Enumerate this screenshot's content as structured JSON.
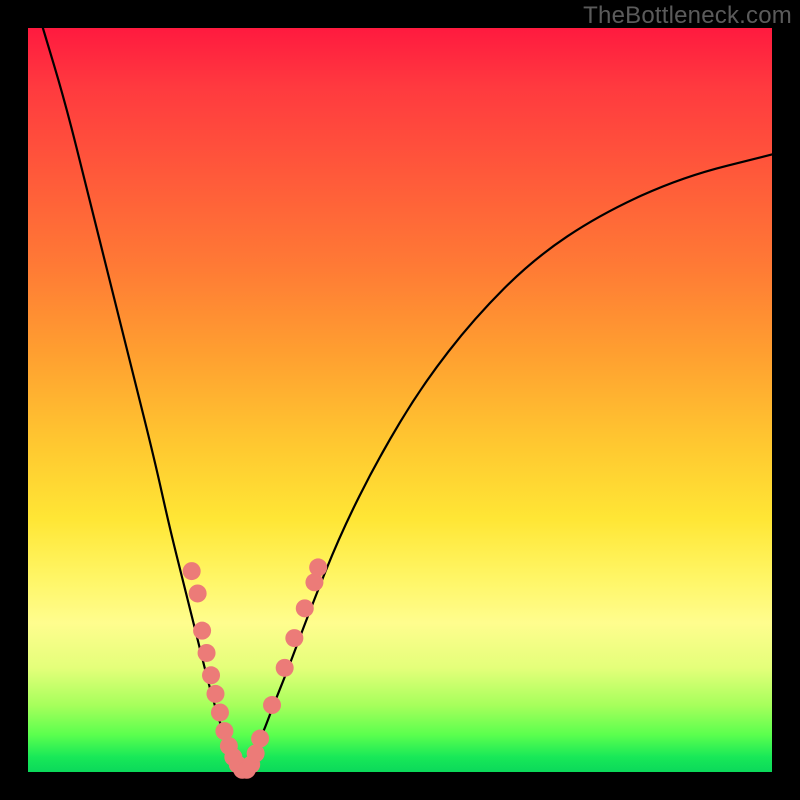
{
  "watermark": "TheBottleneck.com",
  "colors": {
    "background": "#000000",
    "curve": "#000000",
    "marker_fill": "#ec7b78",
    "marker_stroke": "#d85a5a"
  },
  "chart_data": {
    "type": "line",
    "title": "",
    "xlabel": "",
    "ylabel": "",
    "xlim": [
      0,
      100
    ],
    "ylim": [
      0,
      100
    ],
    "legend": false,
    "grid": false,
    "annotations": [
      "TheBottleneck.com"
    ],
    "series": [
      {
        "name": "bottleneck-curve-left",
        "x": [
          2,
          5,
          8,
          11,
          14,
          17,
          19,
          21,
          23,
          24.5,
          26,
          27,
          28,
          28.8
        ],
        "y": [
          100,
          90,
          78,
          66,
          54,
          42,
          33,
          25,
          17,
          11,
          6,
          3,
          1,
          0
        ]
      },
      {
        "name": "bottleneck-curve-right",
        "x": [
          28.8,
          30,
          31.5,
          33,
          35,
          38,
          42,
          47,
          53,
          60,
          68,
          77,
          88,
          100
        ],
        "y": [
          0,
          2,
          5,
          9,
          14,
          22,
          32,
          42,
          52,
          61,
          69,
          75,
          80,
          83
        ]
      }
    ],
    "markers": [
      {
        "x": 22.0,
        "y": 27.0
      },
      {
        "x": 22.8,
        "y": 24.0
      },
      {
        "x": 23.4,
        "y": 19.0
      },
      {
        "x": 24.0,
        "y": 16.0
      },
      {
        "x": 24.6,
        "y": 13.0
      },
      {
        "x": 25.2,
        "y": 10.5
      },
      {
        "x": 25.8,
        "y": 8.0
      },
      {
        "x": 26.4,
        "y": 5.5
      },
      {
        "x": 27.0,
        "y": 3.5
      },
      {
        "x": 27.6,
        "y": 2.0
      },
      {
        "x": 28.2,
        "y": 1.0
      },
      {
        "x": 28.8,
        "y": 0.3
      },
      {
        "x": 29.4,
        "y": 0.3
      },
      {
        "x": 30.0,
        "y": 1.0
      },
      {
        "x": 30.6,
        "y": 2.5
      },
      {
        "x": 31.2,
        "y": 4.5
      },
      {
        "x": 32.8,
        "y": 9.0
      },
      {
        "x": 34.5,
        "y": 14.0
      },
      {
        "x": 35.8,
        "y": 18.0
      },
      {
        "x": 37.2,
        "y": 22.0
      },
      {
        "x": 38.5,
        "y": 25.5
      },
      {
        "x": 39.0,
        "y": 27.5
      }
    ]
  }
}
